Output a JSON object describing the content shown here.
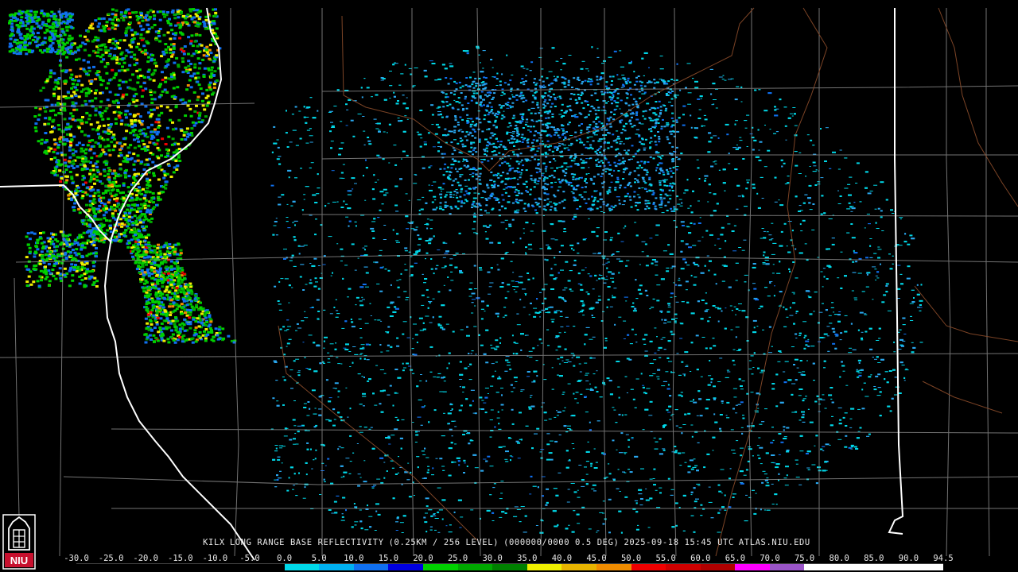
{
  "product": {
    "station": "KILX",
    "title": "LONG RANGE BASE REFLECTIVITY",
    "resolution": "(0.25KM / 256 LEVEL)",
    "volume": "(000000/0000 0.5 DEG)",
    "datetime": "2025-09-18 15:45 UTC",
    "site": "ATLAS.NIU.EDU"
  },
  "legend": {
    "ticks": [
      "-30.0",
      "-25.0",
      "-20.0",
      "-15.0",
      "-10.0",
      "-5.0",
      "0.0",
      "5.0",
      "10.0",
      "15.0",
      "20.0",
      "25.0",
      "30.0",
      "35.0",
      "40.0",
      "45.0",
      "50.0",
      "55.0",
      "60.0",
      "65.0",
      "70.0",
      "75.0",
      "80.0",
      "85.0",
      "90.0",
      "94.5"
    ],
    "colors": [
      "#000000",
      "#000000",
      "#000000",
      "#000000",
      "#000000",
      "#000000",
      "#00d8e8",
      "#00b0f0",
      "#1070f0",
      "#0000e0",
      "#00d000",
      "#00a800",
      "#008000",
      "#f0f000",
      "#e8b400",
      "#f08c00",
      "#f00000",
      "#d00000",
      "#b00000",
      "#ff00ff",
      "#9a55c8",
      "#ffffff",
      "#ffffff",
      "#ffffff",
      "#ffffff"
    ]
  },
  "logo": {
    "text": "NIU",
    "color": "#c8102e"
  },
  "colors": {
    "background": "#000000",
    "county_lines": "#9a9a9a",
    "state_lines": "#ffffff",
    "rivers": "#8a4b2a",
    "echo_light": "#00d8e8",
    "echo_mid": "#1070f0",
    "echo_strong": "#00d000",
    "echo_heavy": "#f0f000",
    "echo_intense": "#f00000"
  }
}
